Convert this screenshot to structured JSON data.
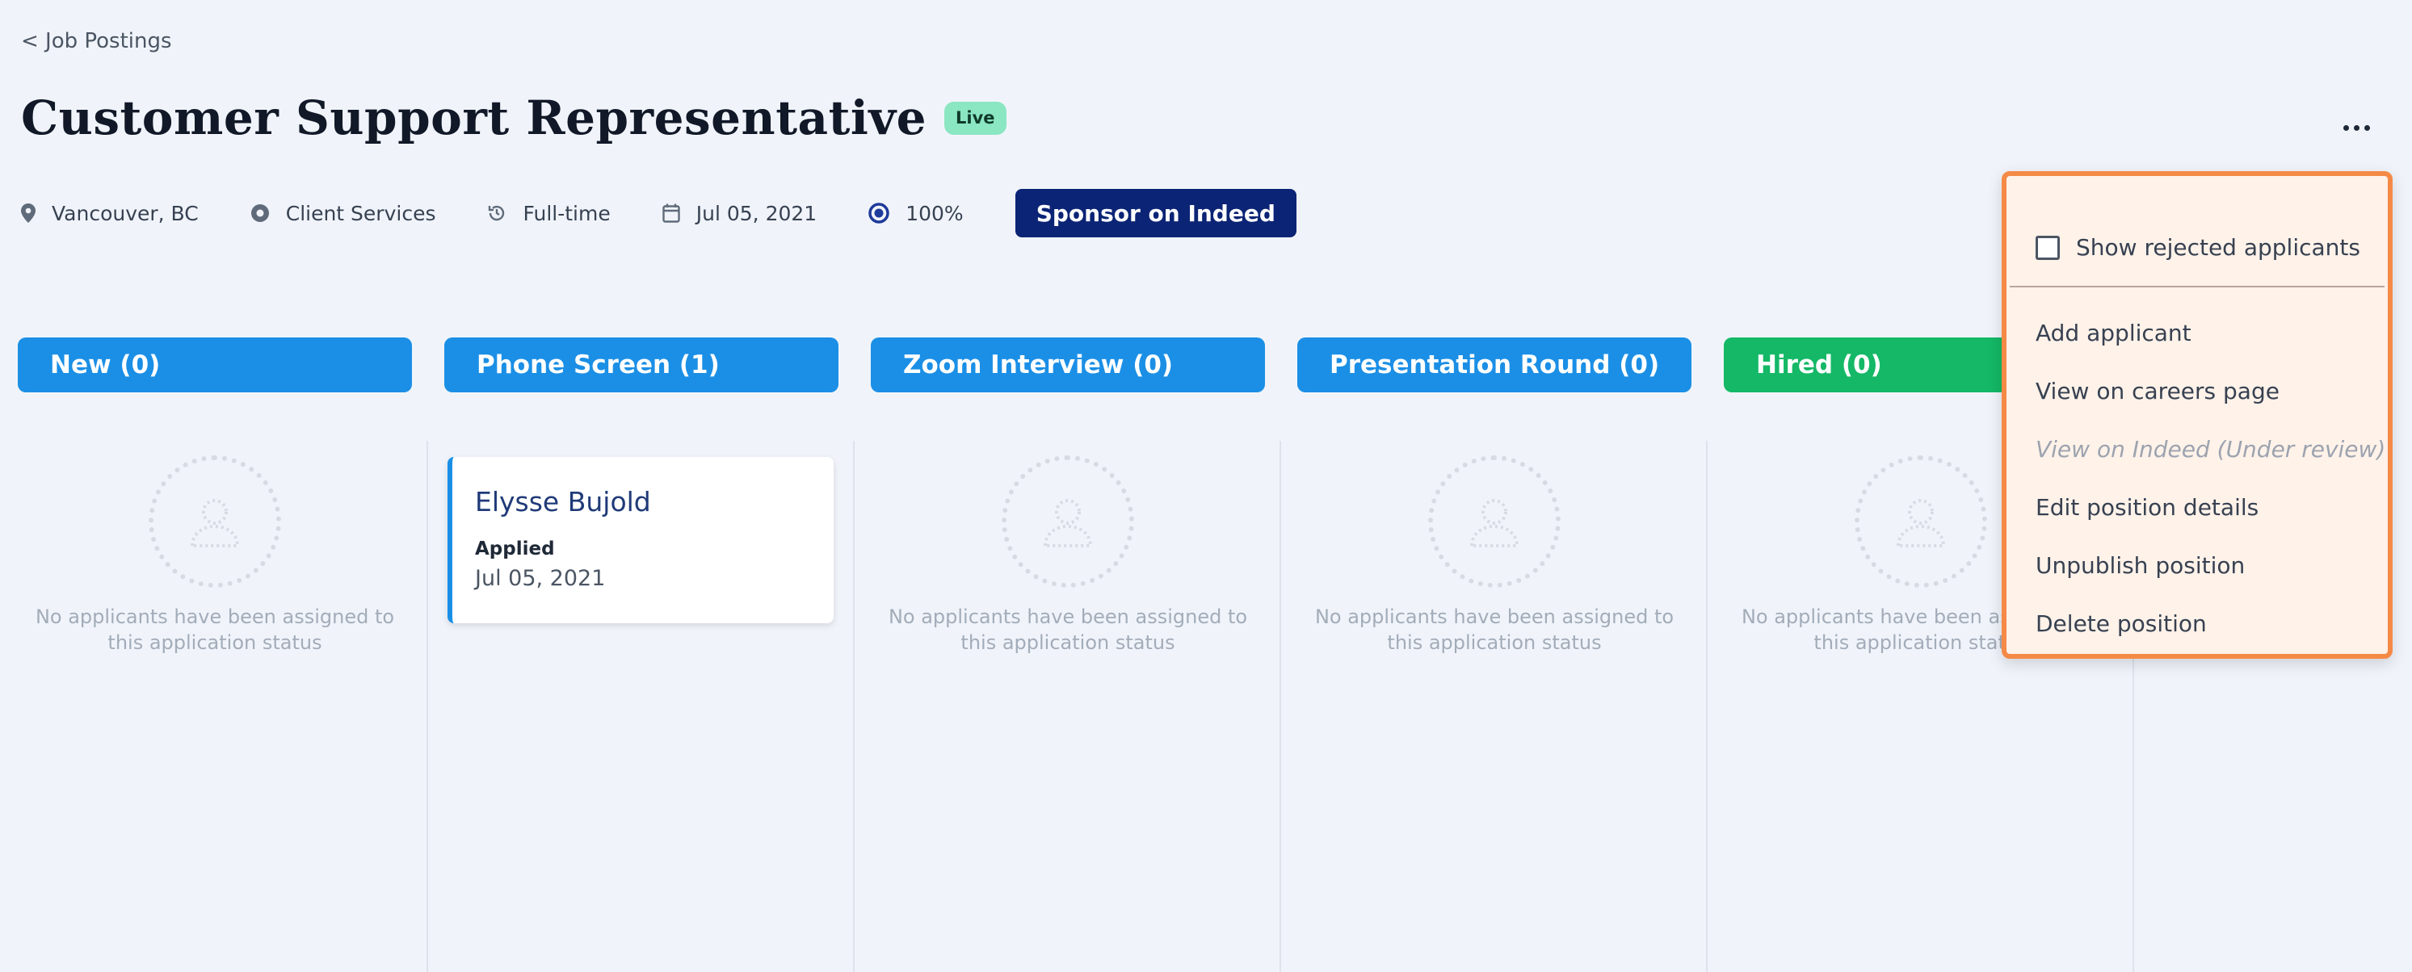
{
  "breadcrumb": "< Job Postings",
  "title": "Customer Support Representative",
  "status_badge": "Live",
  "meta": {
    "location": "Vancouver, BC",
    "department": "Client Services",
    "employment_type": "Full-time",
    "date": "Jul 05, 2021",
    "progress": "100%",
    "sponsor_label": "Sponsor on Indeed"
  },
  "columns": [
    {
      "label": "New (0)",
      "color": "#1b8fe6",
      "empty_text": "No applicants have been assigned to this application status"
    },
    {
      "label": "Phone Screen (1)",
      "color": "#1b8fe6"
    },
    {
      "label": "Zoom Interview (0)",
      "color": "#1b8fe6",
      "empty_text": "No applicants have been assigned to this application status"
    },
    {
      "label": "Presentation Round (0)",
      "color": "#1b8fe6",
      "empty_text": "No applicants have been assigned to this application status"
    },
    {
      "label": "Hired (0)",
      "color": "#14b866",
      "empty_text": "No applicants have been assigned to this application status"
    }
  ],
  "applicant": {
    "name": "Elysse Bujold",
    "status": "Applied",
    "date": "Jul 05, 2021"
  },
  "dropdown": {
    "show_rejected": "Show rejected applicants",
    "items": [
      "Add applicant",
      "View on careers page",
      "View on Indeed (Under review)",
      "Edit position details",
      "Unpublish position",
      "Delete position"
    ]
  },
  "colors": {
    "accent_blue": "#1b8fe6",
    "hired_green": "#14b866",
    "sponsor_navy": "#0b2475",
    "live_badge": "#8be6c2",
    "dropdown_border": "#f58a47",
    "dropdown_bg": "#fff2e9"
  },
  "icons": {
    "location": "map-pin-icon",
    "department": "circle-dot-icon",
    "type": "clock-rotate-icon",
    "date": "calendar-icon",
    "progress": "ring-icon",
    "more": "ellipsis-icon",
    "empty": "user-placeholder-icon"
  }
}
